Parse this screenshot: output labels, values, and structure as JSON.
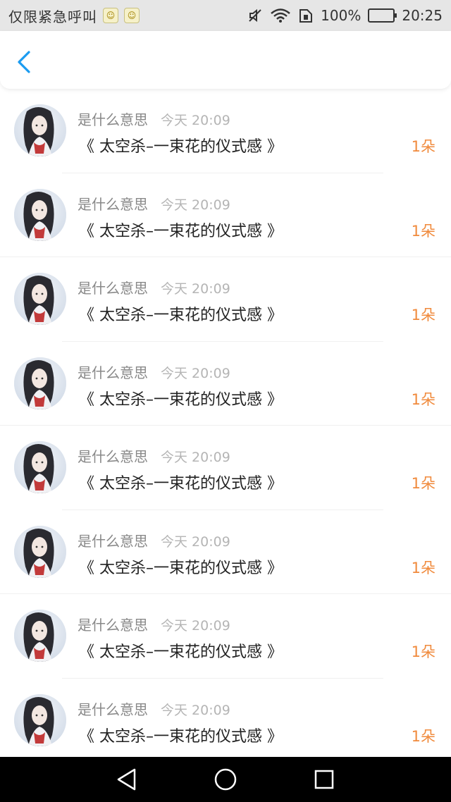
{
  "status_bar": {
    "carrier": "仅限紧急呼叫",
    "battery": "100%",
    "time": "20:25",
    "battery_level": 1.0
  },
  "header": {
    "back_icon": "chevron-left-icon",
    "accent_color": "#1a9bf0"
  },
  "gifts": {
    "items": [
      {
        "name": "是什么意思",
        "time": "今天 20:09",
        "title": "《 太空杀–一束花的仪式感 》",
        "count": "1朵"
      },
      {
        "name": "是什么意思",
        "time": "今天 20:09",
        "title": "《 太空杀–一束花的仪式感 》",
        "count": "1朵"
      },
      {
        "name": "是什么意思",
        "time": "今天 20:09",
        "title": "《 太空杀–一束花的仪式感 》",
        "count": "1朵"
      },
      {
        "name": "是什么意思",
        "time": "今天 20:09",
        "title": "《 太空杀–一束花的仪式感 》",
        "count": "1朵"
      },
      {
        "name": "是什么意思",
        "time": "今天 20:09",
        "title": "《 太空杀–一束花的仪式感 》",
        "count": "1朵"
      },
      {
        "name": "是什么意思",
        "time": "今天 20:09",
        "title": "《 太空杀–一束花的仪式感 》",
        "count": "1朵"
      },
      {
        "name": "是什么意思",
        "time": "今天 20:09",
        "title": "《 太空杀–一束花的仪式感 》",
        "count": "1朵"
      },
      {
        "name": "是什么意思",
        "time": "今天 20:09",
        "title": "《 太空杀–一束花的仪式感 》",
        "count": "1朵"
      }
    ],
    "count_color": "#f08a3c"
  },
  "nav_bar": {
    "icons": [
      "back-triangle-icon",
      "home-circle-icon",
      "recents-square-icon"
    ]
  }
}
